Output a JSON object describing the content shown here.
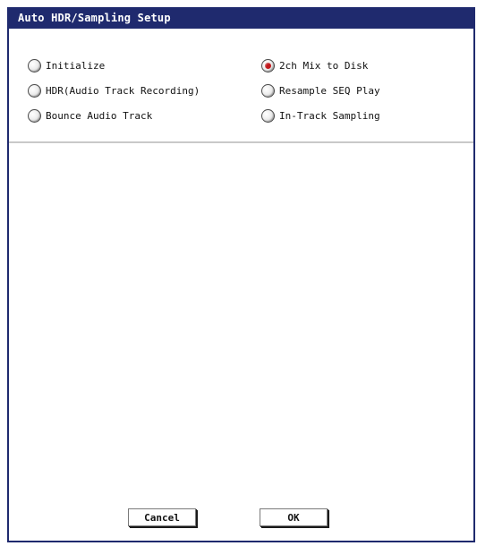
{
  "dialog": {
    "title": "Auto HDR/Sampling Setup"
  },
  "options": [
    {
      "label": "Initialize",
      "checked": false
    },
    {
      "label": "HDR(Audio Track Recording)",
      "checked": false
    },
    {
      "label": "Bounce Audio Track",
      "checked": false
    },
    {
      "label": "2ch Mix to Disk",
      "checked": true
    },
    {
      "label": "Resample SEQ Play",
      "checked": false
    },
    {
      "label": "In-Track Sampling",
      "checked": false
    }
  ],
  "buttons": {
    "cancel": "Cancel",
    "ok": "OK"
  },
  "colors": {
    "titlebar": "#1f2a6e",
    "radio_selected": "#c0181c"
  }
}
